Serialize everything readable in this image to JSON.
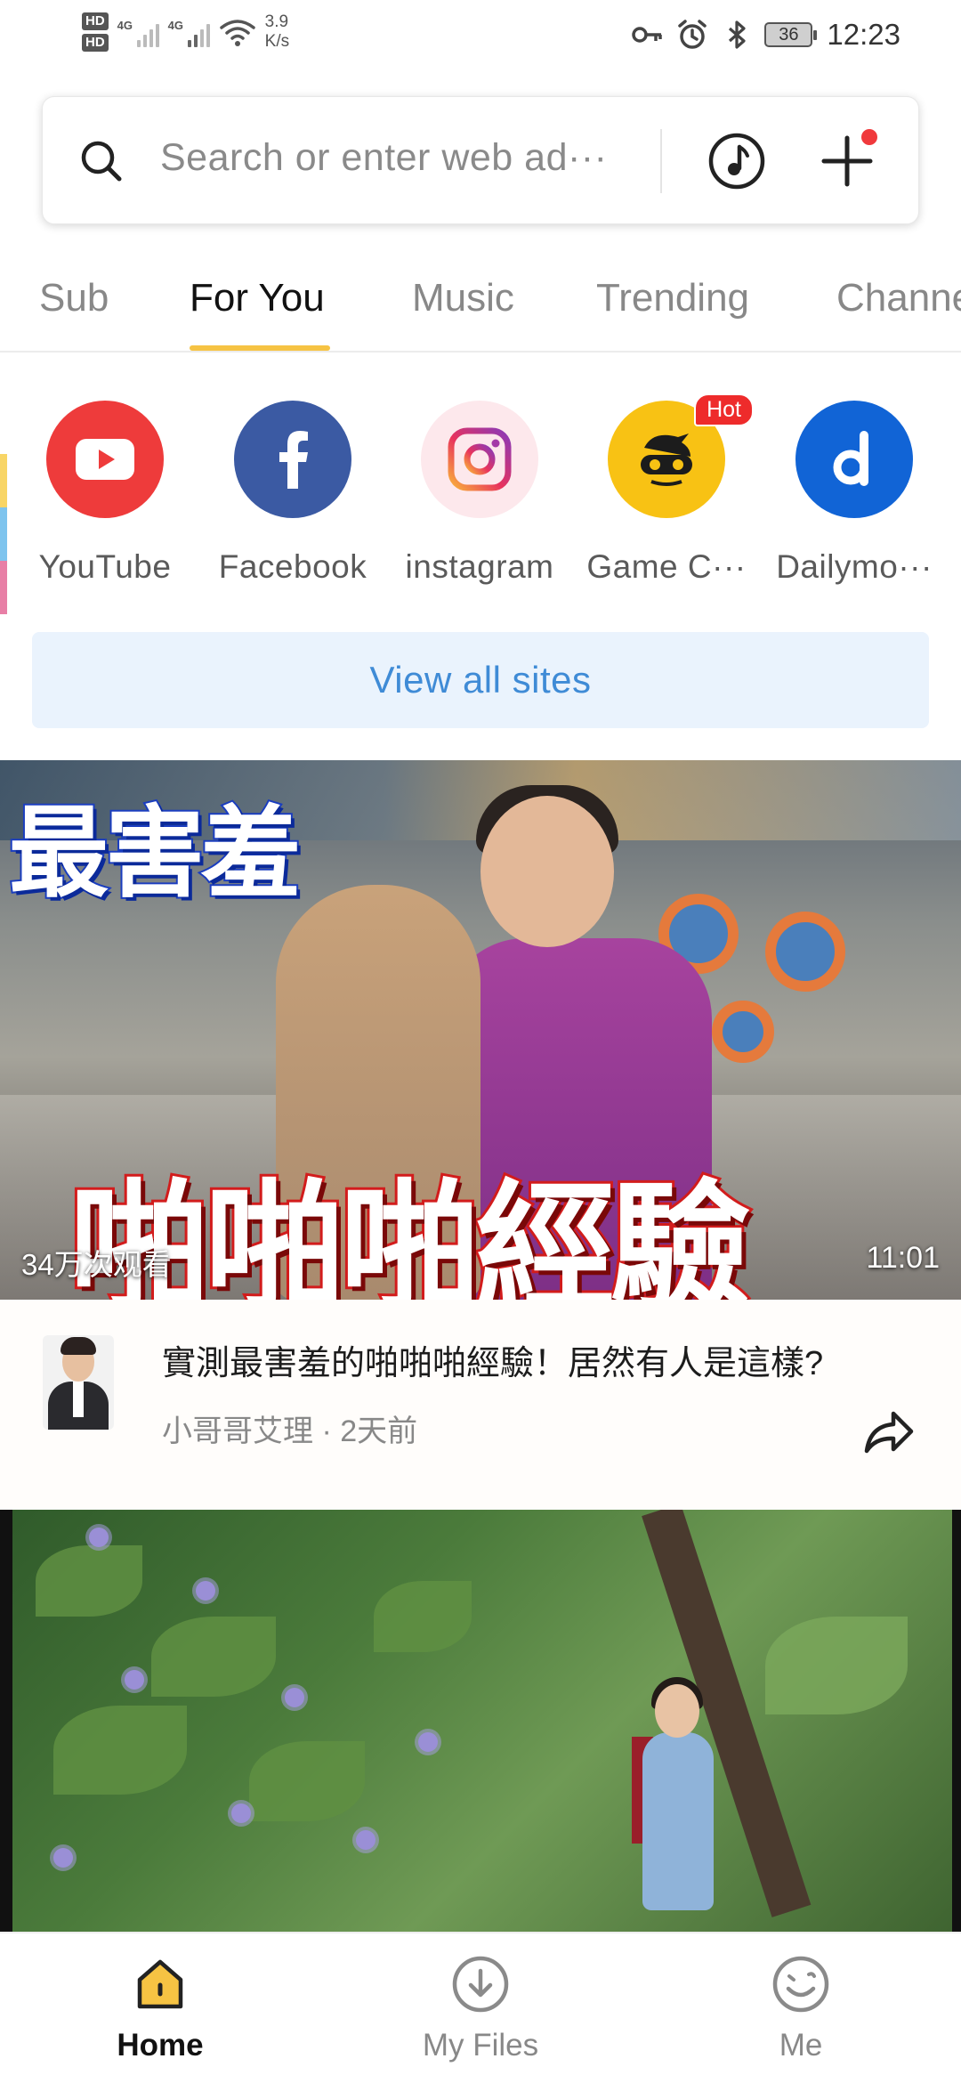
{
  "status_bar": {
    "hd1": "HD",
    "hd2": "HD",
    "net1": "4G",
    "net2": "4G",
    "speed_value": "3.9",
    "speed_unit": "K/s",
    "battery": "36",
    "time": "12:23"
  },
  "search": {
    "placeholder": "Search or enter web ad···"
  },
  "tabs": [
    {
      "label": "Sub"
    },
    {
      "label": "For You"
    },
    {
      "label": "Music"
    },
    {
      "label": "Trending"
    },
    {
      "label": "Channe"
    }
  ],
  "active_tab": "For You",
  "sites": [
    {
      "label": "YouTube",
      "icon": "youtube-icon",
      "color": "#ee3b3b"
    },
    {
      "label": "Facebook",
      "icon": "facebook-icon",
      "color": "#3b5aa3"
    },
    {
      "label": "instagram",
      "icon": "instagram-icon",
      "color": "#fde8ec"
    },
    {
      "label": "Game C···",
      "icon": "game-center-icon",
      "color": "#f8c214",
      "badge": "Hot"
    },
    {
      "label": "Dailymo···",
      "icon": "dailymotion-icon",
      "color": "#1164d6"
    }
  ],
  "view_all": "View all sites",
  "video": {
    "overlay_title_top": "最害羞",
    "overlay_title_main": "啪啪啪經驗",
    "views": "34万次观看",
    "duration": "11:01",
    "title": "實測最害羞的啪啪啪經驗！居然有人是這樣?",
    "channel": "小哥哥艾理",
    "time_ago": "2天前"
  },
  "bottom_nav": [
    {
      "label": "Home",
      "icon": "home-icon"
    },
    {
      "label": "My Files",
      "icon": "download-icon"
    },
    {
      "label": "Me",
      "icon": "smiley-icon"
    }
  ],
  "colors": {
    "accent": "#f6c343",
    "link_blue": "#3f8bd6",
    "view_all_bg": "#eaf3fd",
    "notification_dot": "#f0393c"
  }
}
